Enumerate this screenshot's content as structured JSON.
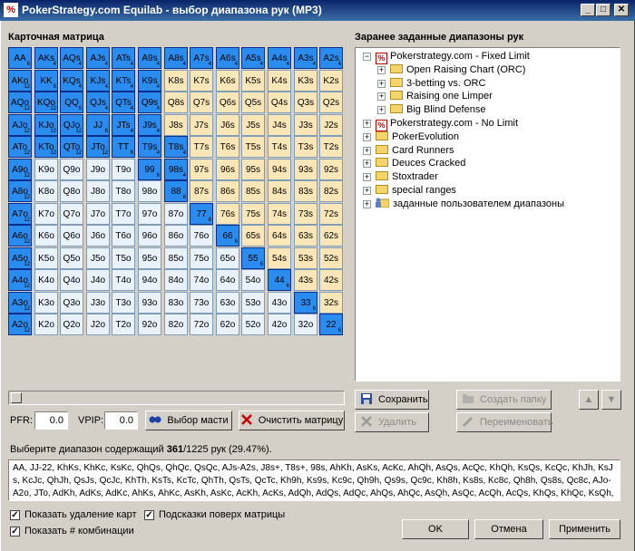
{
  "window": {
    "title": "PokerStrategy.com Equilab - выбор диапазона рук (MP3)"
  },
  "titlebar_buttons": [
    "_",
    "□",
    "✕"
  ],
  "matrix": {
    "header": "Карточная матрица",
    "ranks": [
      "A",
      "K",
      "Q",
      "J",
      "T",
      "9",
      "8",
      "7",
      "6",
      "5",
      "4",
      "3",
      "2"
    ],
    "selected_flags": [
      "1111111111111",
      "1111110000000",
      "1111110000000",
      "1111110000000",
      "1111111000000",
      "1000011000000",
      "1000001000000",
      "1000000100000",
      "1000000010000",
      "1000000001000",
      "1000000000100",
      "1000000000010",
      "1000000000001"
    ]
  },
  "colors": {
    "selected": "#2b8cf0",
    "suited": "#fbe6b8",
    "offsuit": "#e9f1fb",
    "titlebar": "#0a246a"
  },
  "ranges_panel": {
    "header": "Заранее заданные диапазоны рук",
    "tree": [
      {
        "label": "Pokerstrategy.com - Fixed Limit",
        "level": 0,
        "icon": "pokerstrategy-icon",
        "expander": "−"
      },
      {
        "label": "Open Raising Chart (ORC)",
        "level": 1,
        "icon": "folder-icon",
        "expander": "+"
      },
      {
        "label": "3-betting vs. ORC",
        "level": 1,
        "icon": "folder-icon",
        "expander": "+"
      },
      {
        "label": "Raising one Limper",
        "level": 1,
        "icon": "folder-icon",
        "expander": "+"
      },
      {
        "label": "Big Blind Defense",
        "level": 1,
        "icon": "folder-icon",
        "expander": "+"
      },
      {
        "label": "Pokerstrategy.com - No Limit",
        "level": 0,
        "icon": "pokerstrategy-icon",
        "expander": "+"
      },
      {
        "label": "PokerEvolution",
        "level": 0,
        "icon": "folder-icon",
        "expander": "+"
      },
      {
        "label": "Card Runners",
        "level": 0,
        "icon": "folder-icon",
        "expander": "+"
      },
      {
        "label": "Deuces Cracked",
        "level": 0,
        "icon": "folder-icon",
        "expander": "+"
      },
      {
        "label": "Stoxtrader",
        "level": 0,
        "icon": "folder-icon",
        "expander": "+"
      },
      {
        "label": "special ranges",
        "level": 0,
        "icon": "folder-icon",
        "expander": "+"
      },
      {
        "label": "заданные пользователем диапазоны",
        "level": 0,
        "icon": "user-folder-icon",
        "expander": "+"
      }
    ],
    "buttons": {
      "save": "Сохранить",
      "delete": "Удалить",
      "create_folder": "Создать папку",
      "rename": "Переименовать",
      "up": "▲",
      "down": "▼"
    }
  },
  "controls": {
    "pfr_label": "PFR:",
    "pfr_value": "0.0",
    "vpip_label": "VPIP:",
    "vpip_value": "0.0",
    "select_suits": "Выбор масти",
    "clear_matrix": "Очистить матрицу"
  },
  "summary": {
    "prefix": "Выберите диапазон содержащий ",
    "count": "361",
    "suffix": "/1225 рук (29.47%)."
  },
  "range_text": "AA, JJ-22, KhKs, KhKc, KsKc, QhQs, QhQc, QsQc, AJs-A2s, J8s+, T8s+, 98s, AhKh, AsKs, AcKc, AhQh, AsQs, AcQc, KhQh, KsQs, KcQc, KhJh, KsJs, KcJc, QhJh, QsJs, QcJc, KhTh, KsTs, KcTc, QhTh, QsTs, QcTc, Kh9h, Ks9s, Kc9c, Qh9h, Qs9s, Qc9c, Kh8h, Ks8s, Kc8c, Qh8h, Qs8s, Qc8c, AJo-A2o, JTo, AdKh, AdKs, AdKc, AhKs, AhKc, AsKh, AsKc, AcKh, AcKs, AdQh, AdQs, AdQc, AhQs, AhQc, AsQh, AsQc, AcQh, AcQs, KhQs, KhQc, KsQh,",
  "options": {
    "show_card_removal": "Показать удаление карт",
    "show_combos": "Показать # комбинации",
    "matrix_tooltips": "Подсказки поверх матрицы"
  },
  "dialog_buttons": {
    "ok": "OK",
    "cancel": "Отмена",
    "apply": "Применить"
  }
}
